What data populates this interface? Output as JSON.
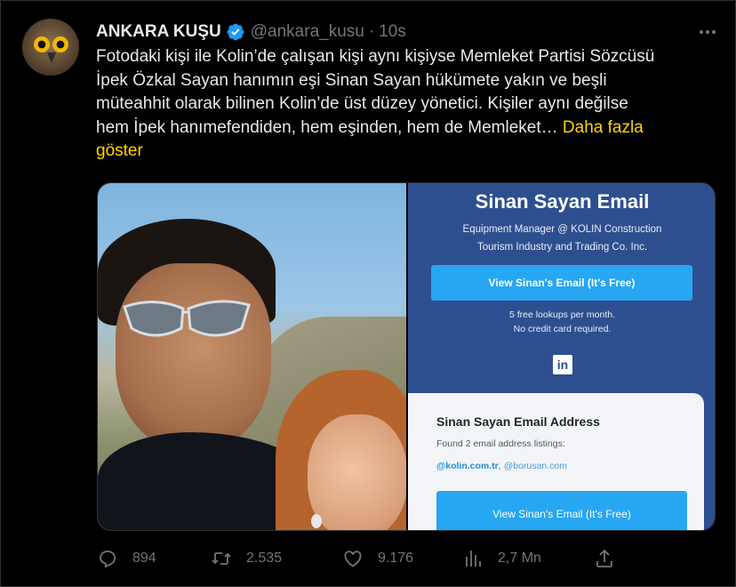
{
  "tweet": {
    "author": {
      "name": "ANKARA KUŞU",
      "handle": "@ankara_kusu",
      "separator": "·",
      "time": "10s",
      "avatar_icon": "owl-avatar"
    },
    "body": {
      "line1": "Fotodaki kişi ile Kolin’de çalışan kişi aynı kişiyse Memleket Partisi Sözcüsü",
      "line2": "İpek Özkal Sayan hanımın eşi Sinan Sayan hükümete yakın ve beşli",
      "line3": "müteahhit olarak bilinen Kolin’de üst düzey yönetici. Kişiler aynı değilse",
      "line4": "hem İpek hanımefendiden, hem eşinden, hem de Memleket…",
      "show_more": "Daha fazla",
      "show_more_2": "göster"
    },
    "card": {
      "title": "Sinan Sayan Email",
      "subtitle_1": "Equipment Manager @ KOLIN Construction",
      "subtitle_2": "Tourism Industry and Trading Co. Inc.",
      "cta": "View Sinan's Email (It's Free)",
      "lookups_1": "5 free lookups per month.",
      "lookups_2": "No credit card required.",
      "linkedin_icon": "in",
      "panel_title": "Sinan Sayan Email Address",
      "panel_found": "Found 2 email address listings:",
      "domain_1": "@kolin.com.tr",
      "domain_sep": ", ",
      "domain_2": "@borusan.com",
      "panel_cta": "View Sinan's Email (It's Free)"
    },
    "actions": {
      "replies": "894",
      "retweets": "2.535",
      "likes": "9.176",
      "views": "2,7 Mn"
    },
    "colors": {
      "background": "#000000",
      "accent_link": "#ffd400",
      "verified": "#1d9bf0",
      "card_bg": "#2e4f8f",
      "cta_bg": "#27a6f2"
    }
  }
}
